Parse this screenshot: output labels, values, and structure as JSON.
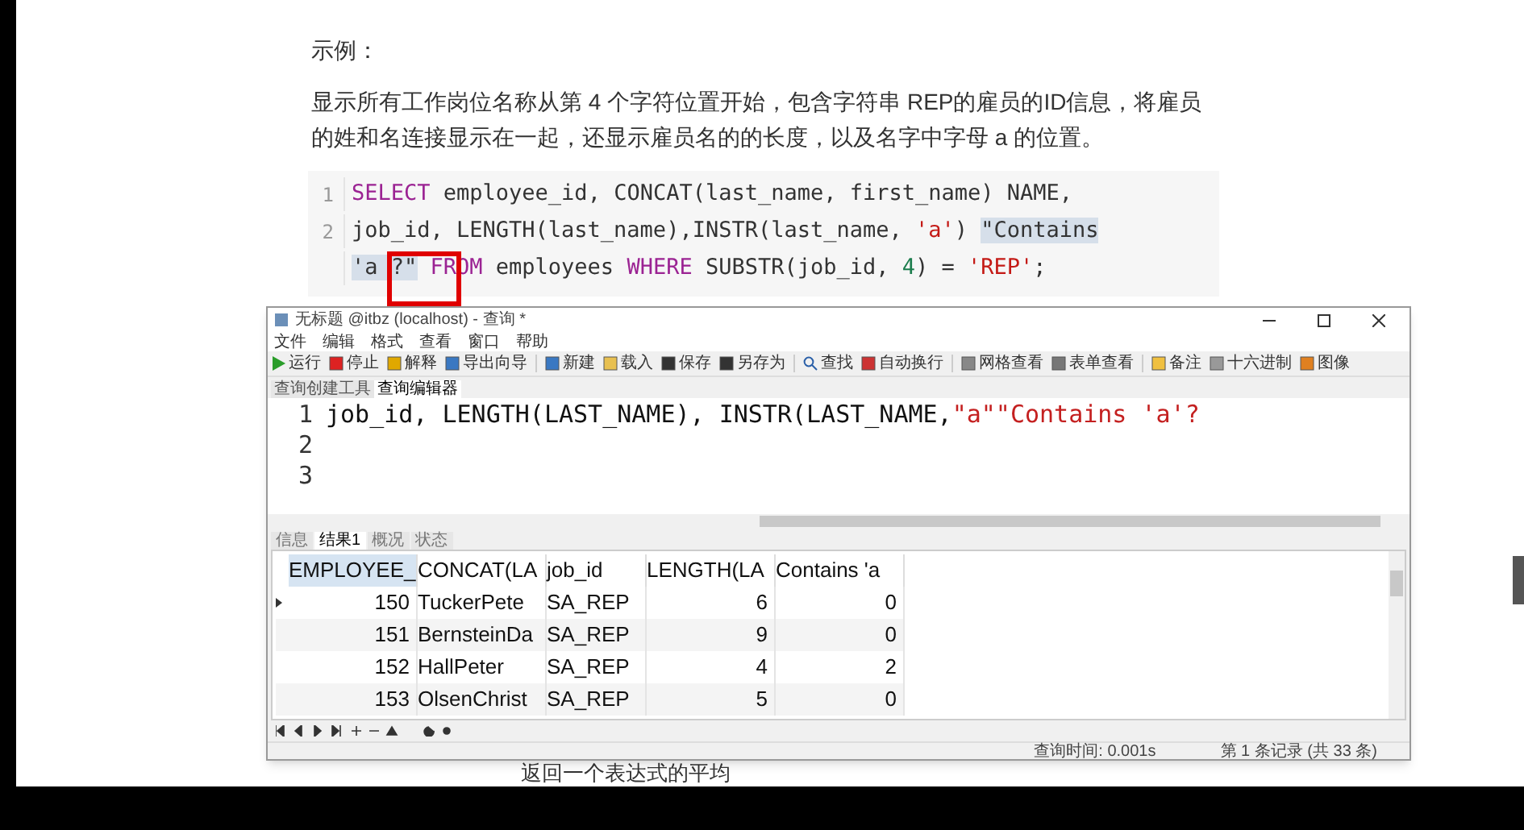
{
  "article": {
    "heading": "示例：",
    "paragraph": "显示所有工作岗位名称从第 4 个字符位置开始，包含字符串 REP的雇员的ID信息，将雇员的姓和名连接显示在一起，还显示雇员名的的长度，以及名字中字母 a 的位置。",
    "code_lines": [
      {
        "number": "1",
        "tokens": [
          {
            "kind": "keyword",
            "text": "SELECT"
          },
          {
            "kind": "plain",
            "text": " employee_id, CONCAT(last_name, first_name) NAME,"
          }
        ]
      },
      {
        "number": "2",
        "tokens": [
          {
            "kind": "plain",
            "text": "job_id, LENGTH(last_name),INSTR(last_name, "
          },
          {
            "kind": "string",
            "text": "'a'"
          },
          {
            "kind": "plain",
            "text": ") "
          },
          {
            "kind": "selected",
            "text": "\"Contains"
          }
        ]
      },
      {
        "tokens": [
          {
            "kind": "selected",
            "text": "'a ?\""
          },
          {
            "kind": "keyword",
            "text": " FROM"
          },
          {
            "kind": "plain",
            "text": " employees "
          },
          {
            "kind": "keyword",
            "text": "WHERE"
          },
          {
            "kind": "plain",
            "text": " SUBSTR(job_id, "
          },
          {
            "kind": "number",
            "text": "4"
          },
          {
            "kind": "plain",
            "text": ") = "
          },
          {
            "kind": "string",
            "text": "'REP'"
          },
          {
            "kind": "plain",
            "text": ";"
          }
        ]
      }
    ],
    "footer_text": "返回一个表达式的平均"
  },
  "window": {
    "title": "无标题 @itbz (localhost) - 查询 *",
    "menu": [
      "文件",
      "编辑",
      "格式",
      "查看",
      "窗口",
      "帮助"
    ],
    "toolbar": [
      {
        "kind": "run",
        "label": "运行"
      },
      {
        "kind": "stop",
        "label": "停止"
      },
      {
        "kind": "explain",
        "label": "解释"
      },
      {
        "kind": "export",
        "label": "导出向导"
      },
      {
        "kind": "sep"
      },
      {
        "kind": "new",
        "label": "新建"
      },
      {
        "kind": "load",
        "label": "载入"
      },
      {
        "kind": "save",
        "label": "保存"
      },
      {
        "kind": "saveas",
        "label": "另存为"
      },
      {
        "kind": "sep"
      },
      {
        "kind": "find",
        "label": "查找"
      },
      {
        "kind": "wrap",
        "label": "自动换行"
      },
      {
        "kind": "sep"
      },
      {
        "kind": "grid",
        "label": "网格查看"
      },
      {
        "kind": "form",
        "label": "表单查看"
      },
      {
        "kind": "sep"
      },
      {
        "kind": "note",
        "label": "备注"
      },
      {
        "kind": "hex",
        "label": "十六进制"
      },
      {
        "kind": "image",
        "label": "图像"
      }
    ],
    "tabs": [
      {
        "label": "查询创建工具",
        "selected": false
      },
      {
        "label": "查询编辑器",
        "selected": true
      }
    ],
    "editor_lines": [
      {
        "number": "1",
        "text": "job_id, LENGTH(LAST_NAME), INSTR(LAST_NAME,",
        "string": "\"a\"",
        "rest": "\"Contains 'a'?"
      },
      {
        "number": "2"
      },
      {
        "number": "3"
      }
    ],
    "result_tabs": [
      {
        "label": "信息",
        "selected": false
      },
      {
        "label": "结果1",
        "selected": true
      },
      {
        "label": "概况",
        "selected": false
      },
      {
        "label": "状态",
        "selected": false
      }
    ],
    "columns": [
      "EMPLOYEE_",
      "CONCAT(LA",
      "job_id",
      "LENGTH(LA",
      "Contains 'a"
    ],
    "rows": [
      {
        "selected": true,
        "cells": [
          "150",
          "TuckerPete",
          "SA_REP",
          "6",
          "0"
        ]
      },
      {
        "selected": false,
        "cells": [
          "151",
          "BernsteinDa",
          "SA_REP",
          "9",
          "0"
        ]
      },
      {
        "selected": false,
        "cells": [
          "152",
          "HallPeter",
          "SA_REP",
          "4",
          "2"
        ]
      },
      {
        "selected": false,
        "cells": [
          "153",
          "OlsenChrist",
          "SA_REP",
          "5",
          "0"
        ]
      }
    ],
    "status": {
      "query_time": "查询时间: 0.001s",
      "record": "第 1 条记录 (共 33 条)"
    }
  }
}
